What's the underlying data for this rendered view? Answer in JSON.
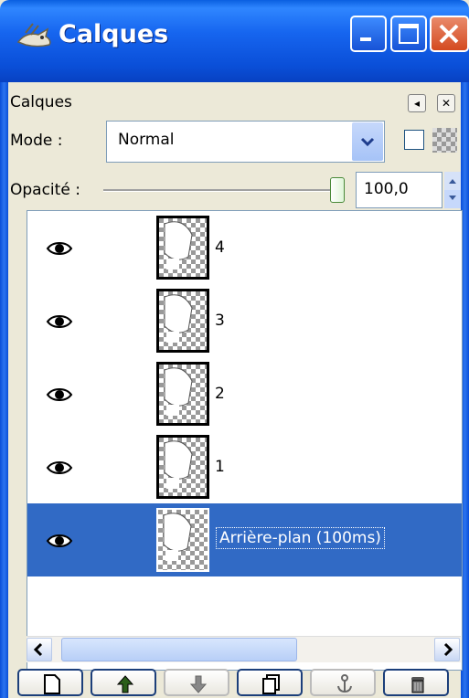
{
  "window": {
    "title": "Calques",
    "icon": "gimp-wilber-icon",
    "controls": [
      "minimize-icon",
      "maximize-icon",
      "close-icon"
    ]
  },
  "dock": {
    "header_label": "Calques",
    "tab_menu_icon": "tab-menu-icon",
    "close_icon": "close-small-icon"
  },
  "mode": {
    "label": "Mode :",
    "value": "Normal",
    "options_visible": [
      "Normal"
    ],
    "keep_transparency_checked": false,
    "lock_icon": "checkerboard-icon"
  },
  "opacity": {
    "label": "Opacité :",
    "value": "100,0",
    "slider_fraction": 1.0
  },
  "layers": [
    {
      "name": "4",
      "visible": true,
      "selected": false
    },
    {
      "name": "3",
      "visible": true,
      "selected": false
    },
    {
      "name": "2",
      "visible": true,
      "selected": false
    },
    {
      "name": "1",
      "visible": true,
      "selected": false
    },
    {
      "name": "Arrière-plan (100ms)",
      "visible": true,
      "selected": true
    }
  ],
  "scrollbar": {
    "left_icon": "arrow-left-icon",
    "right_icon": "arrow-right-icon",
    "thumb_fraction": 0.6
  },
  "toolbar": [
    {
      "name": "new-layer-button",
      "icon": "new-layer-icon"
    },
    {
      "name": "raise-layer-button",
      "icon": "arrow-up-icon"
    },
    {
      "name": "lower-layer-button",
      "icon": "arrow-down-icon"
    },
    {
      "name": "duplicate-layer-button",
      "icon": "duplicate-icon"
    },
    {
      "name": "anchor-layer-button",
      "icon": "anchor-icon"
    },
    {
      "name": "delete-layer-button",
      "icon": "trash-icon"
    }
  ],
  "colors": {
    "titlebar": "#0a4fd8",
    "selection": "#316ac5",
    "close_button": "#d44a20",
    "dialog_bg": "#ece9d8"
  }
}
